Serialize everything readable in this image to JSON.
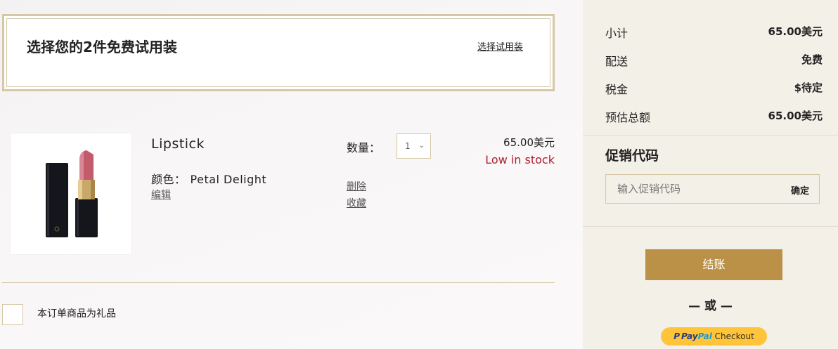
{
  "samples": {
    "title": "选择您的2件免费试用装",
    "link": "选择试用装"
  },
  "product": {
    "name": "Lipstick",
    "color_label": "颜色：",
    "color_value": "Petal Delight",
    "edit": "编辑",
    "qty_label": "数量：",
    "qty_value": "1",
    "remove": "删除",
    "save": "收藏",
    "price": "65.00美元",
    "stock": "Low in stock",
    "image_alt": "lipstick-image"
  },
  "gift": {
    "label": "本订单商品为礼品"
  },
  "summary": {
    "subtotal_label": "小计",
    "subtotal_value": "65.00美元",
    "shipping_label": "配送",
    "shipping_value": "免费",
    "tax_label": "税金",
    "tax_value": "$待定",
    "total_label": "预估总额",
    "total_value": "65.00美元"
  },
  "promo": {
    "title": "促销代码",
    "placeholder": "输入促销代码",
    "apply": "确定"
  },
  "checkout": {
    "button": "结账",
    "or": "— 或 —",
    "paypal_word1": "Pay",
    "paypal_word2": "Pal",
    "paypal_suffix": "Checkout"
  },
  "colors": {
    "accent_gold": "#bb9147",
    "border_gold": "#d6c7a6",
    "stock_red": "#b01f2e",
    "paypal_yellow": "#ffc439"
  }
}
